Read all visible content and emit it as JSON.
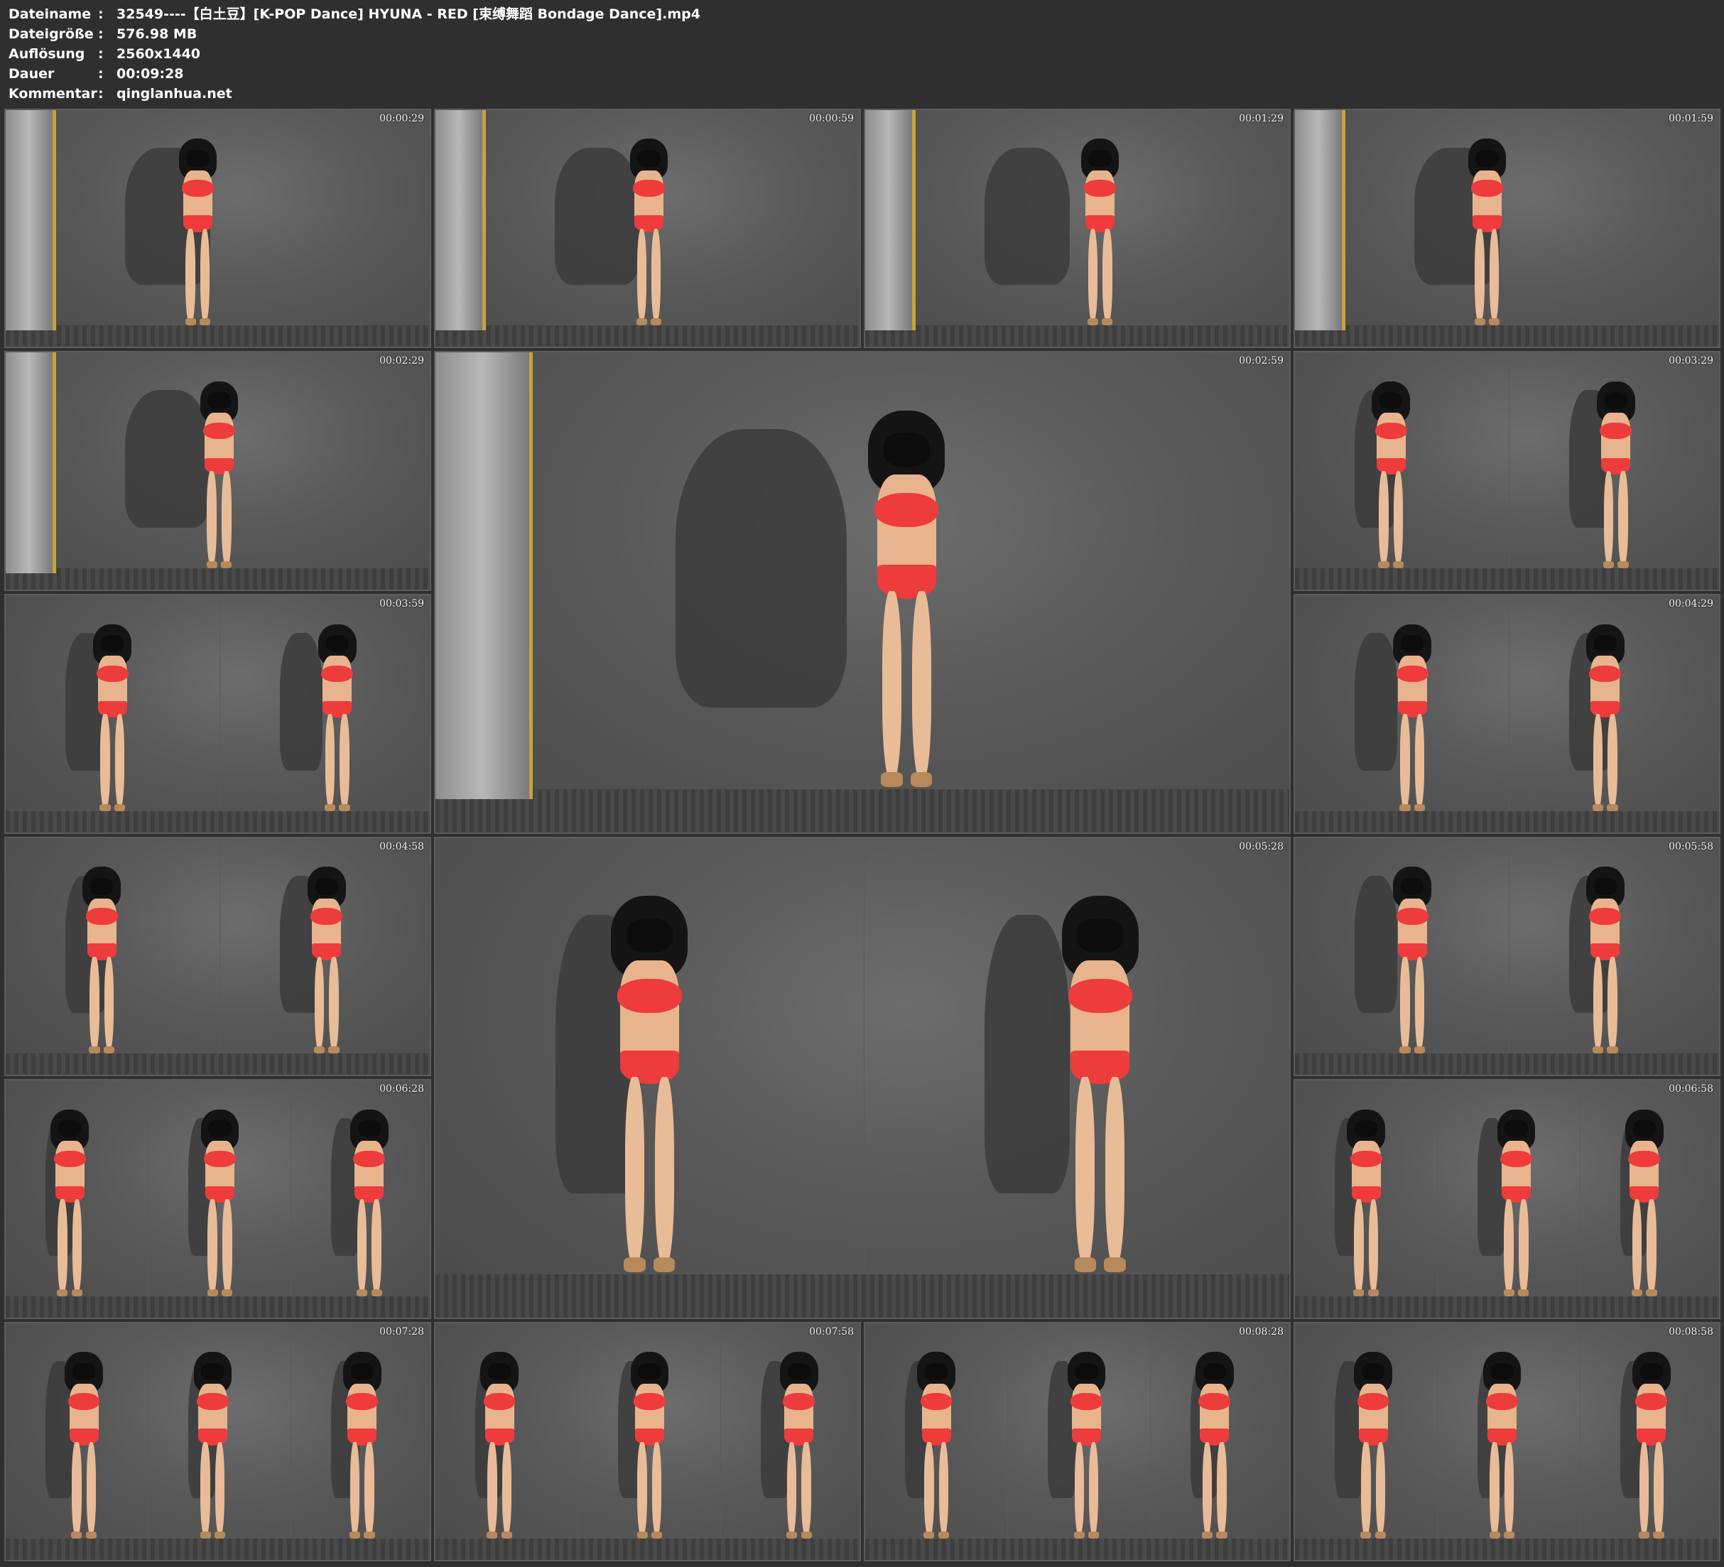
{
  "header": {
    "rows": [
      {
        "label": "Dateiname",
        "sep": ":",
        "value": "32549----【白土豆】[K-POP Dance] HYUNA - RED [束缚舞蹈 Bondage Dance].mp4"
      },
      {
        "label": "Dateigröße",
        "sep": ":",
        "value": "576.98 MB"
      },
      {
        "label": "Auflösung",
        "sep": ":",
        "value": "2560x1440"
      },
      {
        "label": "Dauer",
        "sep": ":",
        "value": "00:09:28"
      },
      {
        "label": "Kommentar",
        "sep": ":",
        "value": "qinglanhua.net"
      }
    ]
  },
  "thumbnails": [
    {
      "time": "00:00:29",
      "panels": 1,
      "frame": true
    },
    {
      "time": "00:00:59",
      "panels": 1,
      "frame": true
    },
    {
      "time": "00:01:29",
      "panels": 1,
      "frame": true
    },
    {
      "time": "00:01:59",
      "panels": 1,
      "frame": true
    },
    {
      "time": "00:02:29",
      "panels": 1,
      "frame": true
    },
    {
      "time": "00:02:59",
      "panels": 1,
      "frame": true
    },
    {
      "time": "00:03:29",
      "panels": 2,
      "frame": false
    },
    {
      "time": "00:03:59",
      "panels": 2,
      "frame": false
    },
    {
      "time": "00:04:29",
      "panels": 2,
      "frame": false
    },
    {
      "time": "00:04:58",
      "panels": 2,
      "frame": false
    },
    {
      "time": "00:05:28",
      "panels": 2,
      "frame": false
    },
    {
      "time": "00:05:58",
      "panels": 2,
      "frame": false
    },
    {
      "time": "00:06:28",
      "panels": 3,
      "frame": false
    },
    {
      "time": "00:06:58",
      "panels": 3,
      "frame": false
    },
    {
      "time": "00:07:28",
      "panels": 3,
      "frame": false
    },
    {
      "time": "00:07:58",
      "panels": 3,
      "frame": false
    },
    {
      "time": "00:08:28",
      "panels": 3,
      "frame": false
    },
    {
      "time": "00:08:58",
      "panels": 3,
      "frame": false
    }
  ],
  "colors": {
    "background": "#2f2f2f",
    "text": "#ffffff",
    "frame_gold": "#c9a23a",
    "bikini_red": "#ee3b3b"
  }
}
